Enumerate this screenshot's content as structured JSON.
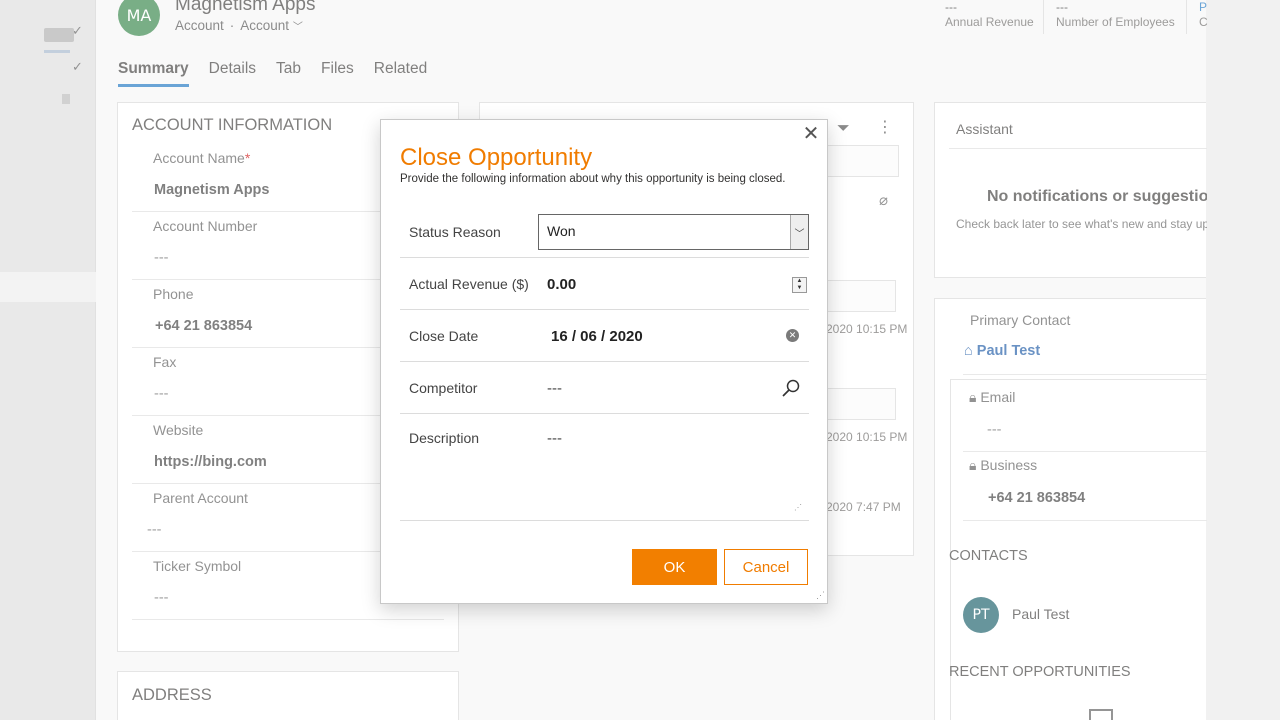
{
  "record": {
    "initials": "MA",
    "title": "Magnetism Apps",
    "entity": "Account",
    "separator": "·",
    "form_selector": "Account",
    "kpis": [
      {
        "value": "---",
        "label": "Annual Revenue"
      },
      {
        "value": "---",
        "label": "Number of Employees"
      },
      {
        "value": "P",
        "label": "C"
      }
    ]
  },
  "tabs": [
    "Summary",
    "Details",
    "Tab",
    "Files",
    "Related"
  ],
  "account_info": {
    "title": "ACCOUNT INFORMATION",
    "required_mark": "*",
    "fields": [
      {
        "label": "Account Name",
        "value": "Magnetism Apps"
      },
      {
        "label": "Account Number",
        "value": "---"
      },
      {
        "label": "Phone",
        "value": "+64 21 863854"
      },
      {
        "label": "Fax",
        "value": "---"
      },
      {
        "label": "Website",
        "value": "https://bing.com"
      },
      {
        "label": "Parent Account",
        "value": "---"
      },
      {
        "label": "Ticker Symbol",
        "value": "---"
      }
    ]
  },
  "address": {
    "title": "ADDRESS"
  },
  "timeline": {
    "timestamps": [
      "2020 10:15 PM",
      "2020 10:15 PM",
      "2020 7:47 PM"
    ]
  },
  "assistant": {
    "title": "Assistant",
    "empty_title": "No notifications or suggestion",
    "empty_body": "Check back later to see what's new and stay up"
  },
  "primary_contact": {
    "label": "Primary Contact",
    "name": "Paul Test",
    "email_label": "Email",
    "email_value": "---",
    "business_label": "Business",
    "business_value": "+64 21 863854"
  },
  "contacts": {
    "title": "CONTACTS",
    "items": [
      {
        "initials": "PT",
        "name": "Paul Test"
      }
    ]
  },
  "recent_opportunities": {
    "title": "RECENT OPPORTUNITIES"
  },
  "dialog": {
    "title": "Close Opportunity",
    "subtitle": "Provide the following information about why this opportunity is being closed.",
    "close_glyph": "✕",
    "status_reason_label": "Status Reason",
    "status_reason_value": "Won",
    "actual_revenue_label": "Actual Revenue ($)",
    "actual_revenue_value": "0.00",
    "close_date_label": "Close Date",
    "close_date_value": "16 / 06 / 2020",
    "competitor_label": "Competitor",
    "competitor_value": "---",
    "description_label": "Description",
    "description_value": "---",
    "ok_label": "OK",
    "cancel_label": "Cancel"
  },
  "colors": {
    "accent": "#f07c00",
    "brand_blue": "#0f6cbd",
    "avatar_green": "#277c3c",
    "contact_teal": "#0b5560"
  }
}
